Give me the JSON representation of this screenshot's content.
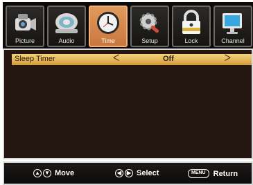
{
  "tabs": [
    {
      "label": "Picture",
      "icon": "camcorder-icon",
      "active": false
    },
    {
      "label": "Audio",
      "icon": "speaker-icon",
      "active": false
    },
    {
      "label": "Time",
      "icon": "clock-icon",
      "active": true
    },
    {
      "label": "Setup",
      "icon": "gear-wrench-icon",
      "active": false
    },
    {
      "label": "Lock",
      "icon": "padlock-icon",
      "active": false
    },
    {
      "label": "Channel",
      "icon": "monitor-icon",
      "active": false
    }
  ],
  "menu": {
    "items": [
      {
        "name": "Sleep Timer",
        "value": "Off"
      }
    ]
  },
  "helpbar": {
    "move": "Move",
    "select": "Select",
    "menu_key": "MENU",
    "return": "Return"
  },
  "colors": {
    "highlight": "#e8b85a",
    "active_tab": "#d9864a",
    "panel_bg": "#241711"
  }
}
